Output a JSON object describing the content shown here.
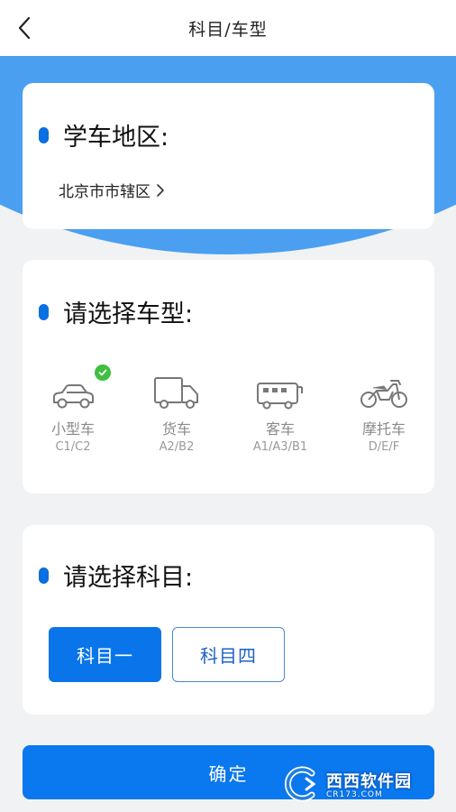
{
  "header": {
    "title": "科目/车型",
    "back_icon": "chevron-left-icon"
  },
  "area_section": {
    "title": "学车地区:",
    "value": "北京市市辖区",
    "chevron": "chevron-right-icon"
  },
  "car_section": {
    "title": "请选择车型:",
    "vehicles": [
      {
        "name": "小型车",
        "license": "C1/C2",
        "icon": "car-icon",
        "selected": true
      },
      {
        "name": "货车",
        "license": "A2/B2",
        "icon": "truck-icon",
        "selected": false
      },
      {
        "name": "客车",
        "license": "A1/A3/B1",
        "icon": "bus-icon",
        "selected": false
      },
      {
        "name": "摩托车",
        "license": "D/E/F",
        "icon": "motorcycle-icon",
        "selected": false
      }
    ]
  },
  "subject_section": {
    "title": "请选择科目:",
    "options": [
      {
        "label": "科目一",
        "selected": true
      },
      {
        "label": "科目四",
        "selected": false
      }
    ]
  },
  "confirm_label": "确定",
  "watermark": {
    "main": "西西软件园",
    "url": "CR173.COM"
  },
  "colors": {
    "accent": "#0a75ea",
    "header_bg": "#4a9ff0",
    "check": "#3fbf3f",
    "page_bg": "#f1f2f4"
  }
}
